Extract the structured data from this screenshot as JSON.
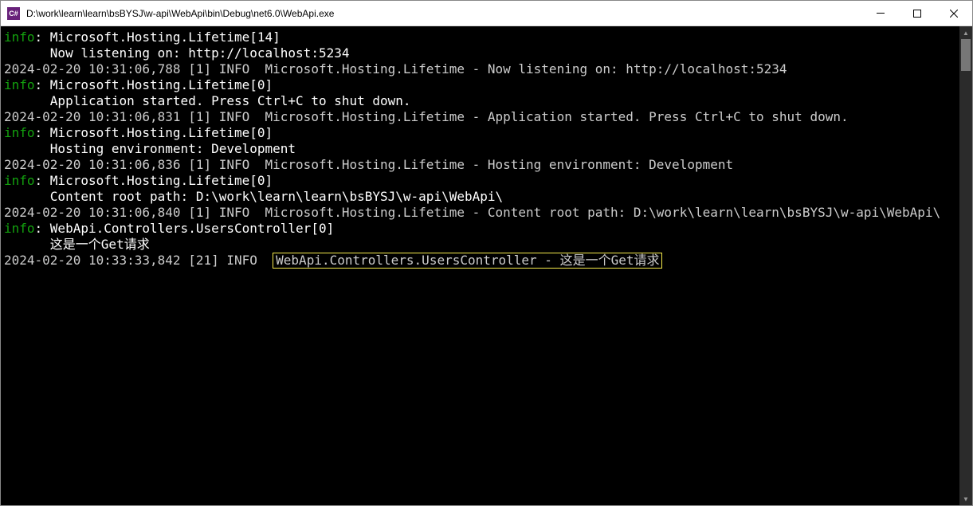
{
  "titlebar": {
    "icon_text": "C#",
    "title": "D:\\work\\learn\\learn\\bsBYSJ\\w-api\\WebApi\\bin\\Debug\\net6.0\\WebApi.exe"
  },
  "log": {
    "info_label": "info",
    "colon": ": ",
    "line1_a": "Microsoft.Hosting.Lifetime[14]",
    "line2": "      Now listening on: http://localhost:5234",
    "line3": "2024-02-20 10:31:06,788 [1] INFO  Microsoft.Hosting.Lifetime - Now listening on: http://localhost:5234",
    "line4_a": "Microsoft.Hosting.Lifetime[0]",
    "line5": "      Application started. Press Ctrl+C to shut down.",
    "line6": "2024-02-20 10:31:06,831 [1] INFO  Microsoft.Hosting.Lifetime - Application started. Press Ctrl+C to shut down.",
    "line7_a": "Microsoft.Hosting.Lifetime[0]",
    "line8": "      Hosting environment: Development",
    "line9": "2024-02-20 10:31:06,836 [1] INFO  Microsoft.Hosting.Lifetime - Hosting environment: Development",
    "line10_a": "Microsoft.Hosting.Lifetime[0]",
    "line11": "      Content root path: D:\\work\\learn\\learn\\bsBYSJ\\w-api\\WebApi\\",
    "line12": "2024-02-20 10:31:06,840 [1] INFO  Microsoft.Hosting.Lifetime - Content root path: D:\\work\\learn\\learn\\bsBYSJ\\w-api\\WebApi\\",
    "line13_a": "WebApi.Controllers.UsersController[0]",
    "line14": "      这是一个Get请求",
    "line15_prefix": "2024-02-20 10:33:33,842 [21] INFO  ",
    "line15_highlight": "WebApi.Controllers.UsersController - 这是一个Get请求"
  }
}
